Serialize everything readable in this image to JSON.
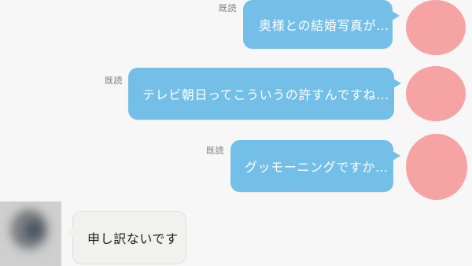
{
  "messages": [
    {
      "read_label": "既読",
      "text": "奥様との結婚写真が…"
    },
    {
      "read_label": "既読",
      "text": "テレビ朝日ってこういうの許すんですね…"
    },
    {
      "read_label": "既読",
      "text": "グッモーニングですか…"
    }
  ],
  "reply": {
    "text": "申し訳ないです"
  },
  "colors": {
    "background": "#f7f7f7",
    "outgoing_bubble": "#74bfe8",
    "incoming_bubble": "#f1f1ee",
    "redaction": "#f6a3a3"
  }
}
